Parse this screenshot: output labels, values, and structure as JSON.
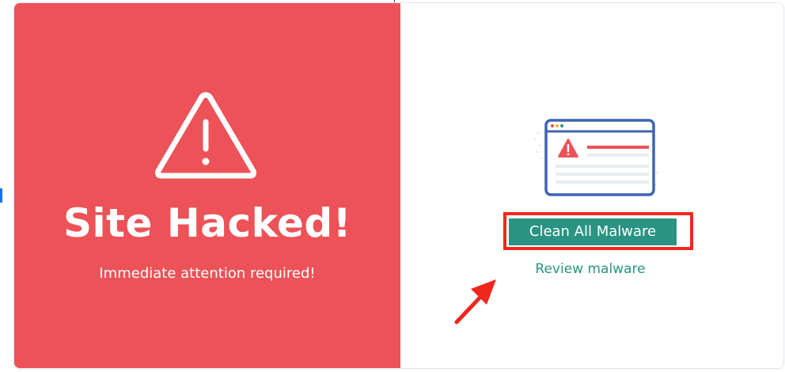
{
  "status": {
    "title": "Site Hacked!",
    "subtitle": "Immediate attention required!",
    "icon": "warning-triangle-icon",
    "color": "#ec5257"
  },
  "actions": {
    "clean_label": "Clean All Malware",
    "review_label": "Review malware",
    "accent": "#2a9382",
    "highlight": "#f0271d"
  },
  "illustration": {
    "icon": "browser-warning-illustration"
  },
  "annotation": {
    "icon": "red-arrow-icon"
  }
}
